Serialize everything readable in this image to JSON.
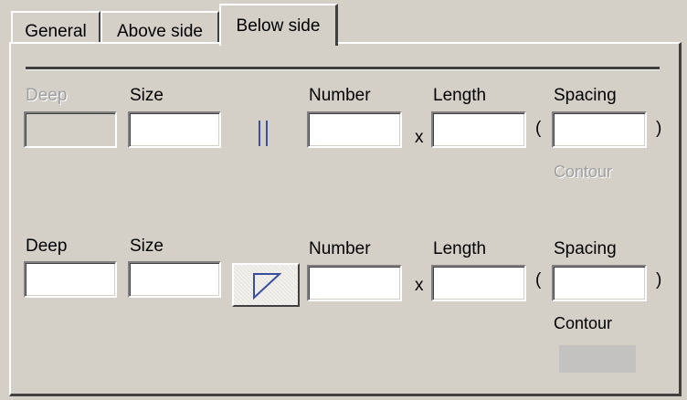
{
  "tabs": [
    {
      "label": "General",
      "selected": false
    },
    {
      "label": "Above side",
      "selected": false
    },
    {
      "label": "Below side",
      "selected": true
    }
  ],
  "row1": {
    "deep_label": "Deep",
    "deep_enabled": false,
    "size_label": "Size",
    "symbol": "parallel-bars-icon",
    "number_label": "Number",
    "times": "x",
    "length_label": "Length",
    "open_paren": "(",
    "spacing_label": "Spacing",
    "close_paren": ")",
    "contour_label": "Contour",
    "contour_enabled": false
  },
  "row2": {
    "deep_label": "Deep",
    "size_label": "Size",
    "symbol": "triangle-icon",
    "number_label": "Number",
    "times": "x",
    "length_label": "Length",
    "open_paren": "(",
    "spacing_label": "Spacing",
    "close_paren": ")",
    "contour_label": "Contour",
    "contour_enabled": true
  },
  "colors": {
    "background": "#d4d0c8",
    "icon_blue": "#3a4ea0",
    "disabled_text": "#a0a0a0"
  }
}
